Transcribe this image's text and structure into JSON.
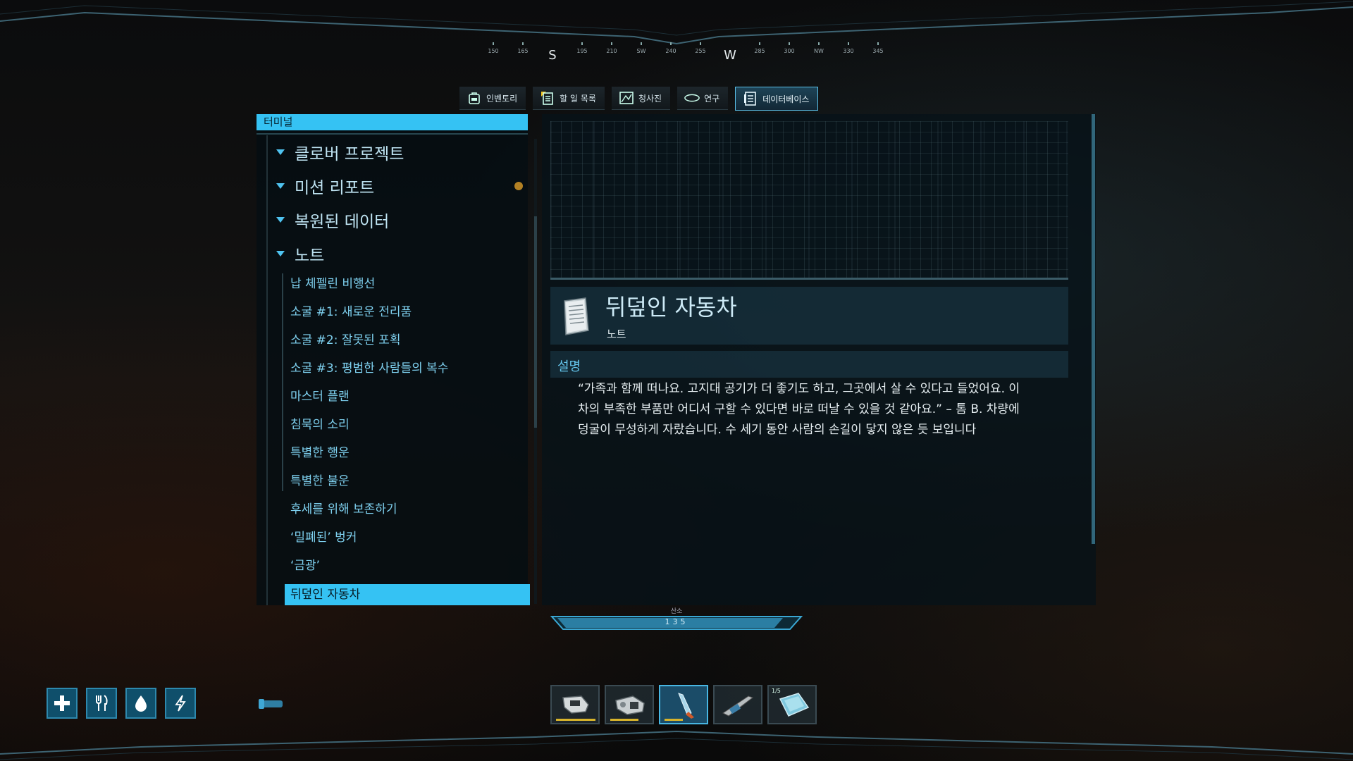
{
  "compass": {
    "ticks": [
      "150",
      "165",
      "195",
      "210",
      "SW",
      "240",
      "255",
      "285",
      "300",
      "NW",
      "330",
      "345"
    ],
    "cardinals": [
      "S",
      "W"
    ]
  },
  "tabs": [
    {
      "label": "인벤토리",
      "icon": "backpack-icon",
      "active": false
    },
    {
      "label": "할 일 목록",
      "icon": "checklist-icon",
      "active": false
    },
    {
      "label": "청사진",
      "icon": "blueprint-icon",
      "active": false
    },
    {
      "label": "연구",
      "icon": "research-icon",
      "active": false
    },
    {
      "label": "데이터베이스",
      "icon": "database-icon",
      "active": true
    }
  ],
  "left_panel": {
    "header": "터미널",
    "categories": [
      {
        "label": "클로버 프로젝트"
      },
      {
        "label": "미션 리포트",
        "has_new": true
      },
      {
        "label": "복원된 데이터"
      },
      {
        "label": "노트"
      }
    ],
    "notes": [
      "납 체펠린 비행선",
      "소굴 #1: 새로운 전리품",
      "소굴 #2: 잘못된 포획",
      "소굴 #3: 평범한 사람들의 복수",
      "마스터 플랜",
      "침묵의 소리",
      "특별한 행운",
      "특별한 불운",
      "후세를 위해 보존하기",
      "‘밀폐된’ 벙커",
      "‘금광’",
      "뒤덮인 자동차"
    ],
    "selected_index": 11
  },
  "detail": {
    "title": "뒤덮인 자동차",
    "subtitle": "노트",
    "section_label": "설명",
    "description": "“가족과 함께 떠나요. 고지대 공기가 더 좋기도 하고, 그곳에서 살 수 있다고 들었어요. 이 차의 부족한 부품만 어디서 구할 수 있다면 바로 떠날 수 있을 것 같아요.” – 톰 B. 차량에 덩굴이 무성하게 자랐습니다. 수 세기 동안 사람의 손길이 닿지 않은 듯 보입니다"
  },
  "oxygen": {
    "label": "산소",
    "value": "135"
  },
  "stats": [
    {
      "icon": "health-cross-icon"
    },
    {
      "icon": "food-fork-icon"
    },
    {
      "icon": "water-drop-icon"
    },
    {
      "icon": "energy-bolt-icon"
    }
  ],
  "hotbar": {
    "slots": [
      {
        "icon": "scanner-tool-icon",
        "durability": 0.85,
        "active": false
      },
      {
        "icon": "repair-tool-icon",
        "durability": 0.65,
        "active": false
      },
      {
        "icon": "knife-icon",
        "durability": 0.4,
        "active": true
      },
      {
        "icon": "harpoon-gun-icon",
        "durability": 0,
        "active": false
      },
      {
        "icon": "glass-block-icon",
        "durability": 0,
        "active": false,
        "count": "1/5"
      }
    ]
  },
  "colors": {
    "accent": "#35c2f3",
    "selection_text": "#061b24",
    "new_marker": "#b38124",
    "durability": "#d8b42b"
  }
}
